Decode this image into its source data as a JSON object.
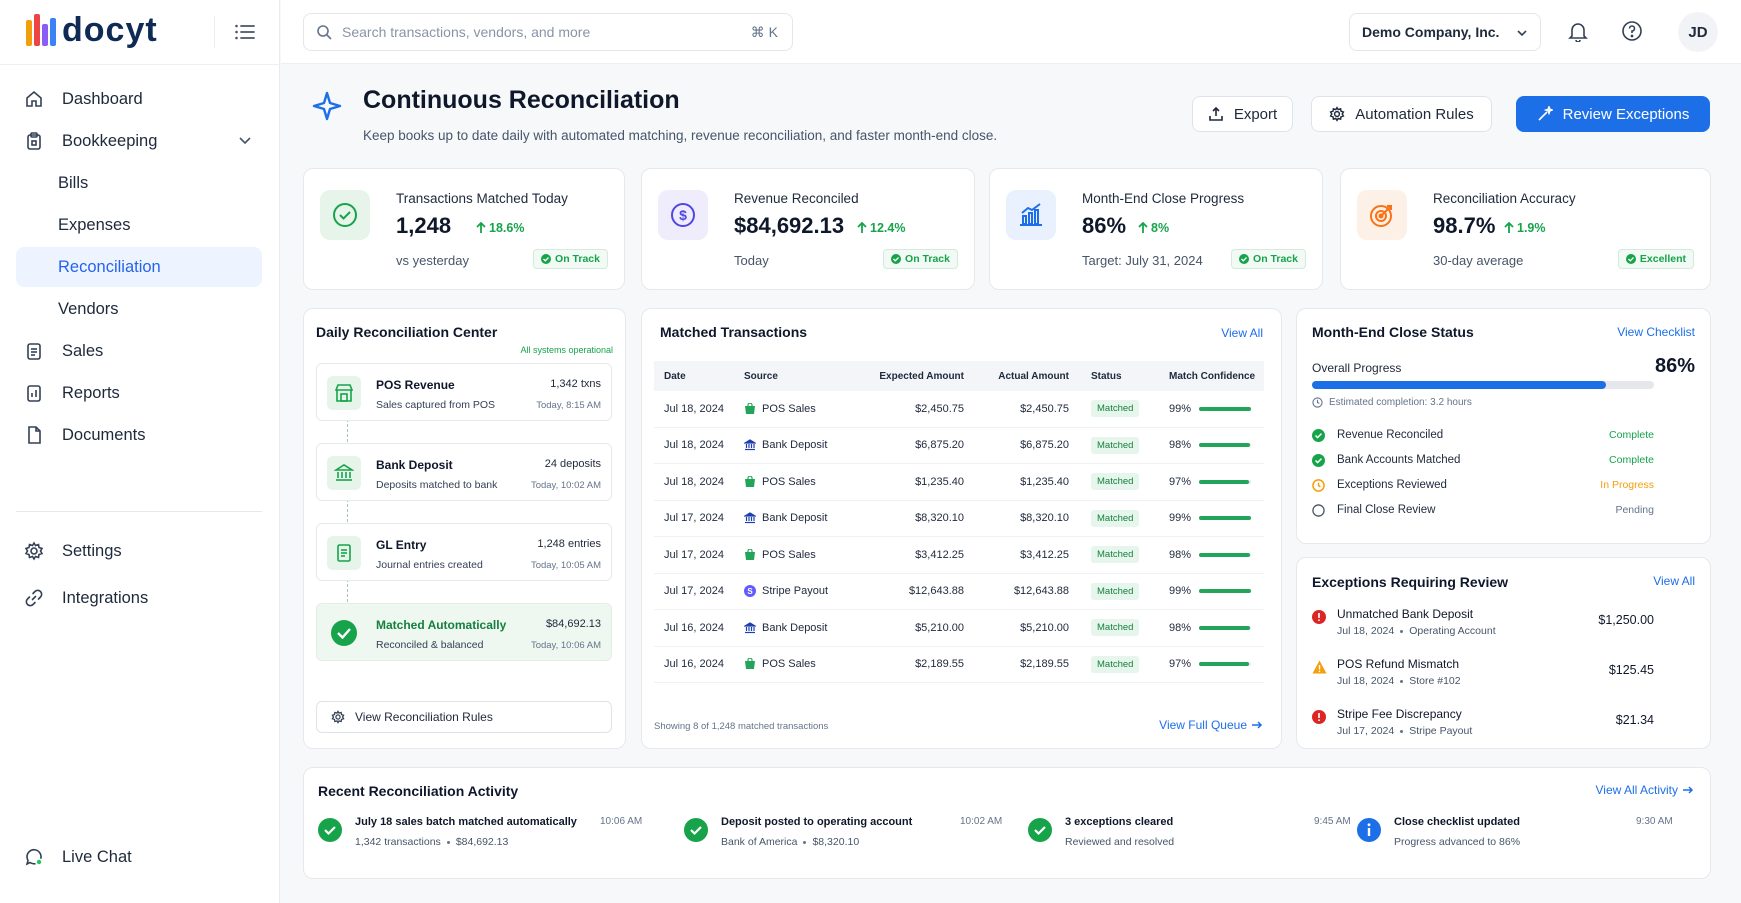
{
  "app": {
    "brand": "docyt"
  },
  "sidebar": {
    "items": [
      {
        "label": "Dashboard"
      },
      {
        "label": "Bookkeeping"
      },
      {
        "label": "Bills"
      },
      {
        "label": "Expenses"
      },
      {
        "label": "Reconciliation"
      },
      {
        "label": "Vendors"
      },
      {
        "label": "Sales"
      },
      {
        "label": "Reports"
      },
      {
        "label": "Documents"
      },
      {
        "label": "Settings"
      },
      {
        "label": "Integrations"
      }
    ],
    "live_chat": "Live Chat"
  },
  "topbar": {
    "search_placeholder": "Search transactions, vendors, and more",
    "search_shortcut": "⌘ K",
    "company": "Demo Company, Inc.",
    "avatar": "JD"
  },
  "page": {
    "title": "Continuous Reconciliation",
    "subtitle": "Keep books up to date daily with automated matching, revenue reconciliation, and faster month-end close.",
    "actions": {
      "export": "Export",
      "automation": "Automation Rules",
      "review": "Review Exceptions"
    }
  },
  "kpis": [
    {
      "label": "Transactions Matched Today",
      "value": "1,248",
      "delta": "18.6%",
      "note": "vs yesterday",
      "badge": "On Track"
    },
    {
      "label": "Revenue Reconciled",
      "value": "$84,692.13",
      "delta": "12.4%",
      "note": "Today",
      "badge": "On Track"
    },
    {
      "label": "Month-End Close Progress",
      "value": "86%",
      "delta": "8%",
      "note": "Target: July 31, 2024",
      "badge": "On Track"
    },
    {
      "label": "Reconciliation Accuracy",
      "value": "98.7%",
      "delta": "1.9%",
      "note": "30-day average",
      "badge": "Excellent"
    }
  ],
  "daily_center": {
    "title": "Daily Reconciliation Center",
    "status": "All systems operational",
    "steps": [
      {
        "title": "POS Revenue",
        "sub": "Sales captured from POS",
        "count": "1,342 txns",
        "time": "Today, 8:15 AM"
      },
      {
        "title": "Bank Deposit",
        "sub": "Deposits matched to bank",
        "count": "24 deposits",
        "time": "Today, 10:02 AM"
      },
      {
        "title": "GL Entry",
        "sub": "Journal entries created",
        "count": "1,248 entries",
        "time": "Today, 10:05 AM"
      },
      {
        "title": "Matched Automatically",
        "sub": "Reconciled & balanced",
        "count": "$84,692.13",
        "time": "Today, 10:06 AM"
      }
    ],
    "rules_button": "View Reconciliation Rules"
  },
  "matched": {
    "title": "Matched Transactions",
    "view_all": "View All",
    "columns": [
      "Date",
      "Source",
      "Expected Amount",
      "Actual Amount",
      "Status",
      "Match Confidence"
    ],
    "rows": [
      {
        "date": "Jul 18, 2024",
        "source": "POS Sales",
        "icon": "pos-icon",
        "expected": "$2,450.75",
        "actual": "$2,450.75",
        "status": "Matched",
        "confidence": "99%",
        "conf_value": 99
      },
      {
        "date": "Jul 18, 2024",
        "source": "Bank Deposit",
        "icon": "bank-icon",
        "expected": "$6,875.20",
        "actual": "$6,875.20",
        "status": "Matched",
        "confidence": "98%",
        "conf_value": 98
      },
      {
        "date": "Jul 18, 2024",
        "source": "POS Sales",
        "icon": "pos-icon",
        "expected": "$1,235.40",
        "actual": "$1,235.40",
        "status": "Matched",
        "confidence": "97%",
        "conf_value": 97
      },
      {
        "date": "Jul 17, 2024",
        "source": "Bank Deposit",
        "icon": "bank-icon",
        "expected": "$8,320.10",
        "actual": "$8,320.10",
        "status": "Matched",
        "confidence": "99%",
        "conf_value": 99
      },
      {
        "date": "Jul 17, 2024",
        "source": "POS Sales",
        "icon": "pos-icon",
        "expected": "$3,412.25",
        "actual": "$3,412.25",
        "status": "Matched",
        "confidence": "98%",
        "conf_value": 98
      },
      {
        "date": "Jul 17, 2024",
        "source": "Stripe Payout",
        "icon": "stripe-icon",
        "expected": "$12,643.88",
        "actual": "$12,643.88",
        "status": "Matched",
        "confidence": "99%",
        "conf_value": 99
      },
      {
        "date": "Jul 16, 2024",
        "source": "Bank Deposit",
        "icon": "bank-icon",
        "expected": "$5,210.00",
        "actual": "$5,210.00",
        "status": "Matched",
        "confidence": "98%",
        "conf_value": 98
      },
      {
        "date": "Jul 16, 2024",
        "source": "POS Sales",
        "icon": "pos-icon",
        "expected": "$2,189.55",
        "actual": "$2,189.55",
        "status": "Matched",
        "confidence": "97%",
        "conf_value": 97
      }
    ],
    "footer": "Showing 8 of 1,248 matched transactions",
    "view_queue": "View Full Queue"
  },
  "month_end": {
    "title": "Month-End Close Status",
    "view_checklist": "View Checklist",
    "progress_label": "Overall Progress",
    "progress_text": "86%",
    "progress_value": 86,
    "estimate": "Estimated completion: 3.2 hours",
    "checklist": [
      {
        "label": "Revenue Reconciled",
        "status": "Complete",
        "color": "#16a34a"
      },
      {
        "label": "Bank Accounts Matched",
        "status": "Complete",
        "color": "#16a34a"
      },
      {
        "label": "Exceptions Reviewed",
        "status": "In Progress",
        "color": "#f59e0b"
      },
      {
        "label": "Final Close Review",
        "status": "Pending",
        "color": "#64748b"
      }
    ]
  },
  "exceptions": {
    "title": "Exceptions Requiring Review",
    "view_all": "View All",
    "items": [
      {
        "title": "Unmatched Bank Deposit",
        "date": "Jul 18, 2024",
        "account": "Operating Account",
        "amount": "$1,250.00",
        "level": "error"
      },
      {
        "title": "POS Refund Mismatch",
        "date": "Jul 18, 2024",
        "account": "Store #102",
        "amount": "$125.45",
        "level": "warning"
      },
      {
        "title": "Stripe Fee Discrepancy",
        "date": "Jul 17, 2024",
        "account": "Stripe Payout",
        "amount": "$21.34",
        "level": "error"
      }
    ]
  },
  "activity": {
    "title": "Recent Reconciliation Activity",
    "view_all": "View All Activity",
    "items": [
      {
        "title": "July 18 sales batch matched automatically",
        "sub1": "1,342 transactions",
        "sub2": "$84,692.13",
        "time": "10:06 AM",
        "icon": "check"
      },
      {
        "title": "Deposit posted to operating account",
        "sub1": "Bank of America",
        "sub2": "$8,320.10",
        "time": "10:02 AM",
        "icon": "check"
      },
      {
        "title": "3 exceptions cleared",
        "sub1": "Reviewed and resolved",
        "sub2": "",
        "time": "9:45 AM",
        "icon": "check"
      },
      {
        "title": "Close checklist updated",
        "sub1": "Progress advanced to 86%",
        "sub2": "",
        "time": "9:30 AM",
        "icon": "info"
      }
    ]
  }
}
